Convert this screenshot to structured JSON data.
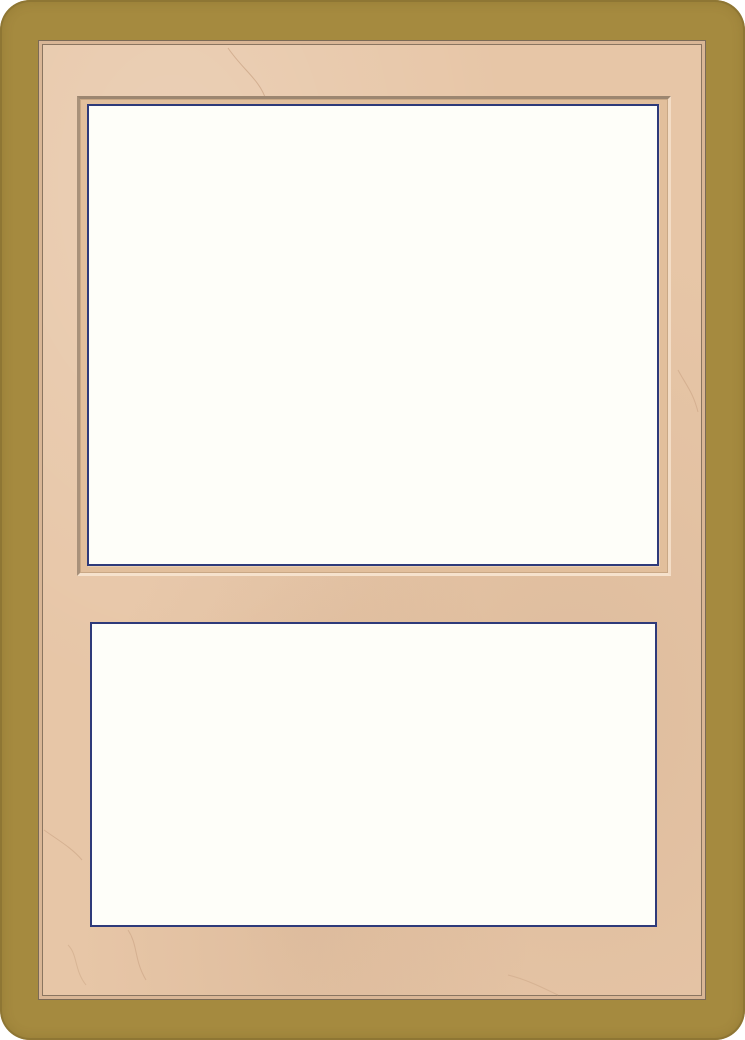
{
  "card": {
    "border_color": "#a58a3f",
    "frame_color": "#e7c6a7",
    "window_color": "#fefef9",
    "window_outline_color": "#2e3a7a"
  }
}
